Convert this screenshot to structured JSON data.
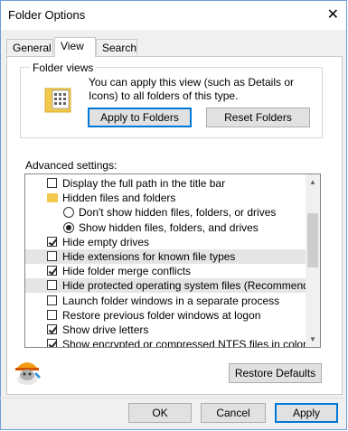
{
  "window": {
    "title": "Folder Options",
    "close_glyph": "✕"
  },
  "tabs": [
    {
      "label": "General"
    },
    {
      "label": "View"
    },
    {
      "label": "Search"
    }
  ],
  "folder_views": {
    "label": "Folder views",
    "description": "You can apply this view (such as Details or Icons) to all folders of this type.",
    "apply_button": "Apply to Folders",
    "reset_button": "Reset Folders"
  },
  "advanced": {
    "label": "Advanced settings:",
    "items": [
      {
        "type": "checkbox",
        "label": "Display the full path in the title bar",
        "checked": false,
        "indent": 1,
        "highlight": false
      },
      {
        "type": "folder",
        "label": "Hidden files and folders",
        "indent": 1,
        "highlight": false
      },
      {
        "type": "radio",
        "label": "Don't show hidden files, folders, or drives",
        "checked": false,
        "indent": 2,
        "highlight": false
      },
      {
        "type": "radio",
        "label": "Show hidden files, folders, and drives",
        "checked": true,
        "indent": 2,
        "highlight": false
      },
      {
        "type": "checkbox",
        "label": "Hide empty drives",
        "checked": true,
        "indent": 1,
        "highlight": false
      },
      {
        "type": "checkbox",
        "label": "Hide extensions for known file types",
        "checked": false,
        "indent": 1,
        "highlight": true
      },
      {
        "type": "checkbox",
        "label": "Hide folder merge conflicts",
        "checked": true,
        "indent": 1,
        "highlight": false
      },
      {
        "type": "checkbox",
        "label": "Hide protected operating system files (Recommended)",
        "checked": false,
        "indent": 1,
        "highlight": true
      },
      {
        "type": "checkbox",
        "label": "Launch folder windows in a separate process",
        "checked": false,
        "indent": 1,
        "highlight": false
      },
      {
        "type": "checkbox",
        "label": "Restore previous folder windows at logon",
        "checked": false,
        "indent": 1,
        "highlight": false
      },
      {
        "type": "checkbox",
        "label": "Show drive letters",
        "checked": true,
        "indent": 1,
        "highlight": false
      },
      {
        "type": "checkbox",
        "label": "Show encrypted or compressed NTFS files in color",
        "checked": true,
        "indent": 1,
        "highlight": false
      }
    ],
    "restore_button": "Restore Defaults"
  },
  "footer": {
    "ok": "OK",
    "cancel": "Cancel",
    "apply": "Apply"
  },
  "colors": {
    "accent": "#0078d7",
    "highlight_row": "#e5e5e5",
    "folder": "#f2c94c"
  }
}
